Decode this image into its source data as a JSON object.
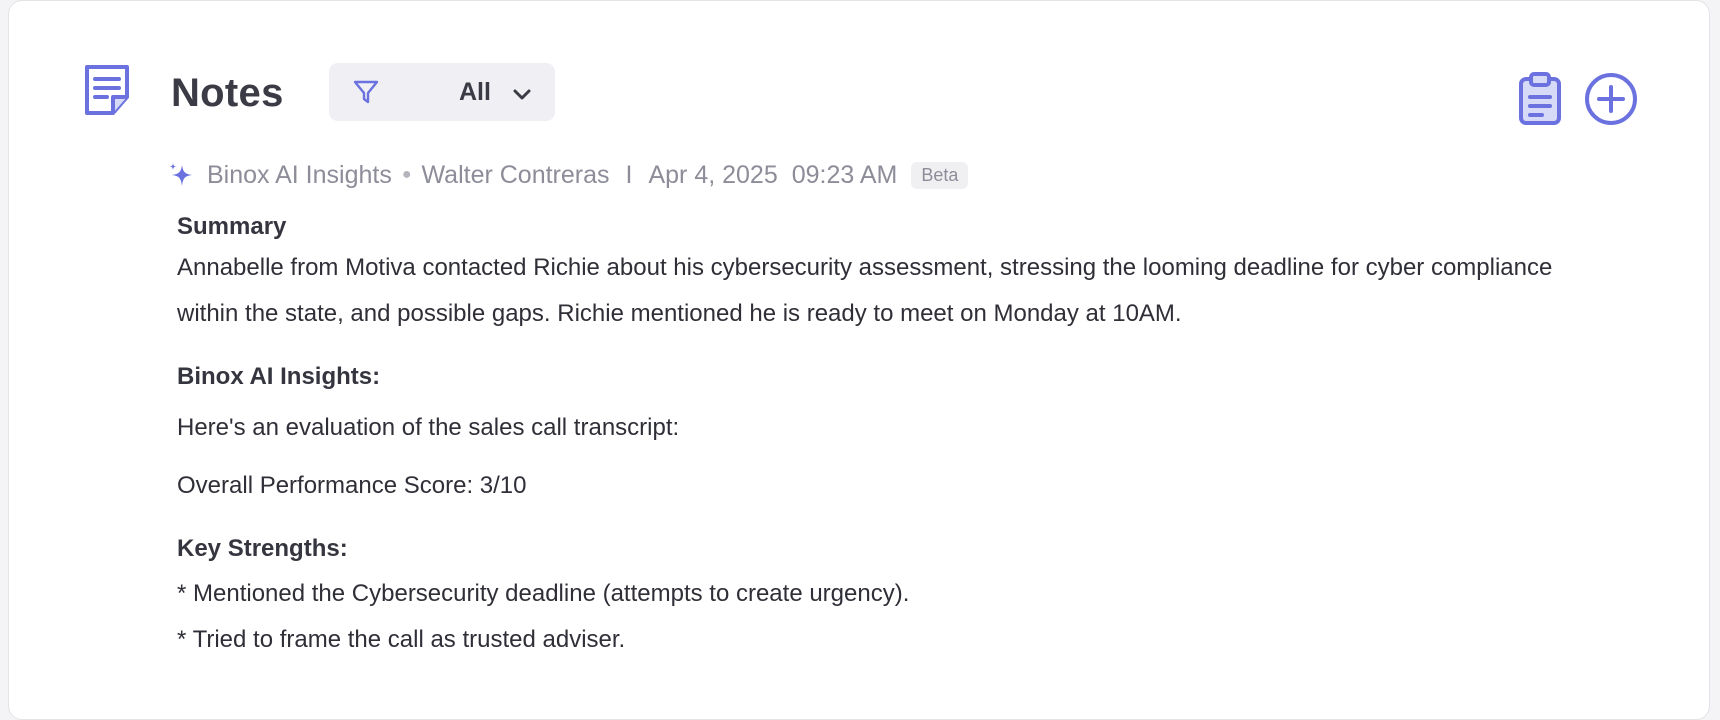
{
  "header": {
    "title": "Notes",
    "filter_value": "All"
  },
  "meta": {
    "source": "Binox AI Insights",
    "author": "Walter Contreras",
    "separator": "I",
    "date": "Apr 4, 2025",
    "time": "09:23 AM",
    "badge": "Beta"
  },
  "note": {
    "summary_heading": "Summary",
    "summary_text": "Annabelle from Motiva contacted Richie about his cybersecurity assessment, stressing the looming deadline for cyber compliance within the state, and possible gaps. Richie mentioned he is ready to meet on Monday at 10AM.",
    "insights_heading": "Binox AI Insights:",
    "intro": "Here's an evaluation of the sales call transcript:",
    "score": "Overall Performance Score: 3/10",
    "strengths_heading": "Key Strengths:",
    "strengths": [
      "* Mentioned the Cybersecurity deadline (attempts to create urgency).",
      "* Tried to frame the call as trusted adviser."
    ]
  },
  "colors": {
    "accent": "#6b72e0",
    "accent_fill": "#d7daf7",
    "muted_text": "#8d8d99"
  },
  "icons": {
    "notes": "notes-icon",
    "filter": "funnel-icon",
    "dropdown": "chevron-down-icon",
    "clipboard": "clipboard-icon",
    "add": "plus-circle-icon",
    "ai": "sparkle-icon"
  }
}
